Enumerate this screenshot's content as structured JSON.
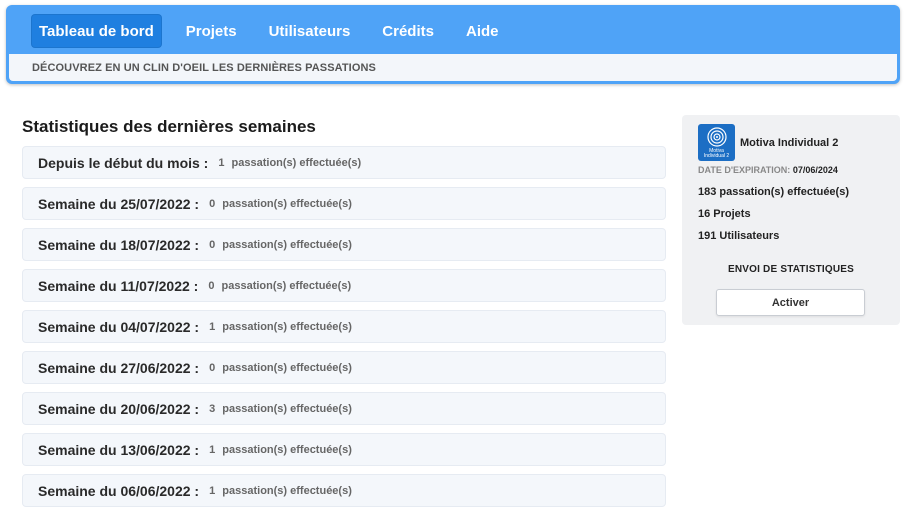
{
  "nav": {
    "items": [
      {
        "label": "Tableau de bord",
        "active": true
      },
      {
        "label": "Projets",
        "active": false
      },
      {
        "label": "Utilisateurs",
        "active": false
      },
      {
        "label": "Crédits",
        "active": false
      },
      {
        "label": "Aide",
        "active": false
      }
    ],
    "subtitle": "DÉCOUVREZ EN UN CLIN D'OEIL LES DERNIÈRES PASSATIONS"
  },
  "stats": {
    "title": "Statistiques des dernières semaines",
    "suffix": "passation(s) effectuée(s)",
    "rows": [
      {
        "label": "Depuis le début du mois :",
        "count": "1"
      },
      {
        "label": "Semaine du 25/07/2022 :",
        "count": "0"
      },
      {
        "label": "Semaine du 18/07/2022 :",
        "count": "0"
      },
      {
        "label": "Semaine du 11/07/2022 :",
        "count": "0"
      },
      {
        "label": "Semaine du 04/07/2022 :",
        "count": "1"
      },
      {
        "label": "Semaine du 27/06/2022 :",
        "count": "0"
      },
      {
        "label": "Semaine du 20/06/2022 :",
        "count": "3"
      },
      {
        "label": "Semaine du 13/06/2022 :",
        "count": "1"
      },
      {
        "label": "Semaine du 06/06/2022 :",
        "count": "1"
      }
    ]
  },
  "card": {
    "logo_text_1": "Motiva",
    "logo_text_2": "Individual 2",
    "product_name": "Motiva Individual 2",
    "expiry_label": "DATE D'EXPIRATION:",
    "expiry_value": "07/06/2024",
    "passations": "183 passation(s) effectuée(s)",
    "projects": "16 Projets",
    "users": "191 Utilisateurs",
    "send_title": "ENVOI DE STATISTIQUES",
    "activate_label": "Activer",
    "logo_icon": "concentric-circles-icon"
  },
  "colors": {
    "header": "#4fa3f7",
    "nav_active": "#1f7fe0",
    "logo": "#1c6ec4"
  }
}
